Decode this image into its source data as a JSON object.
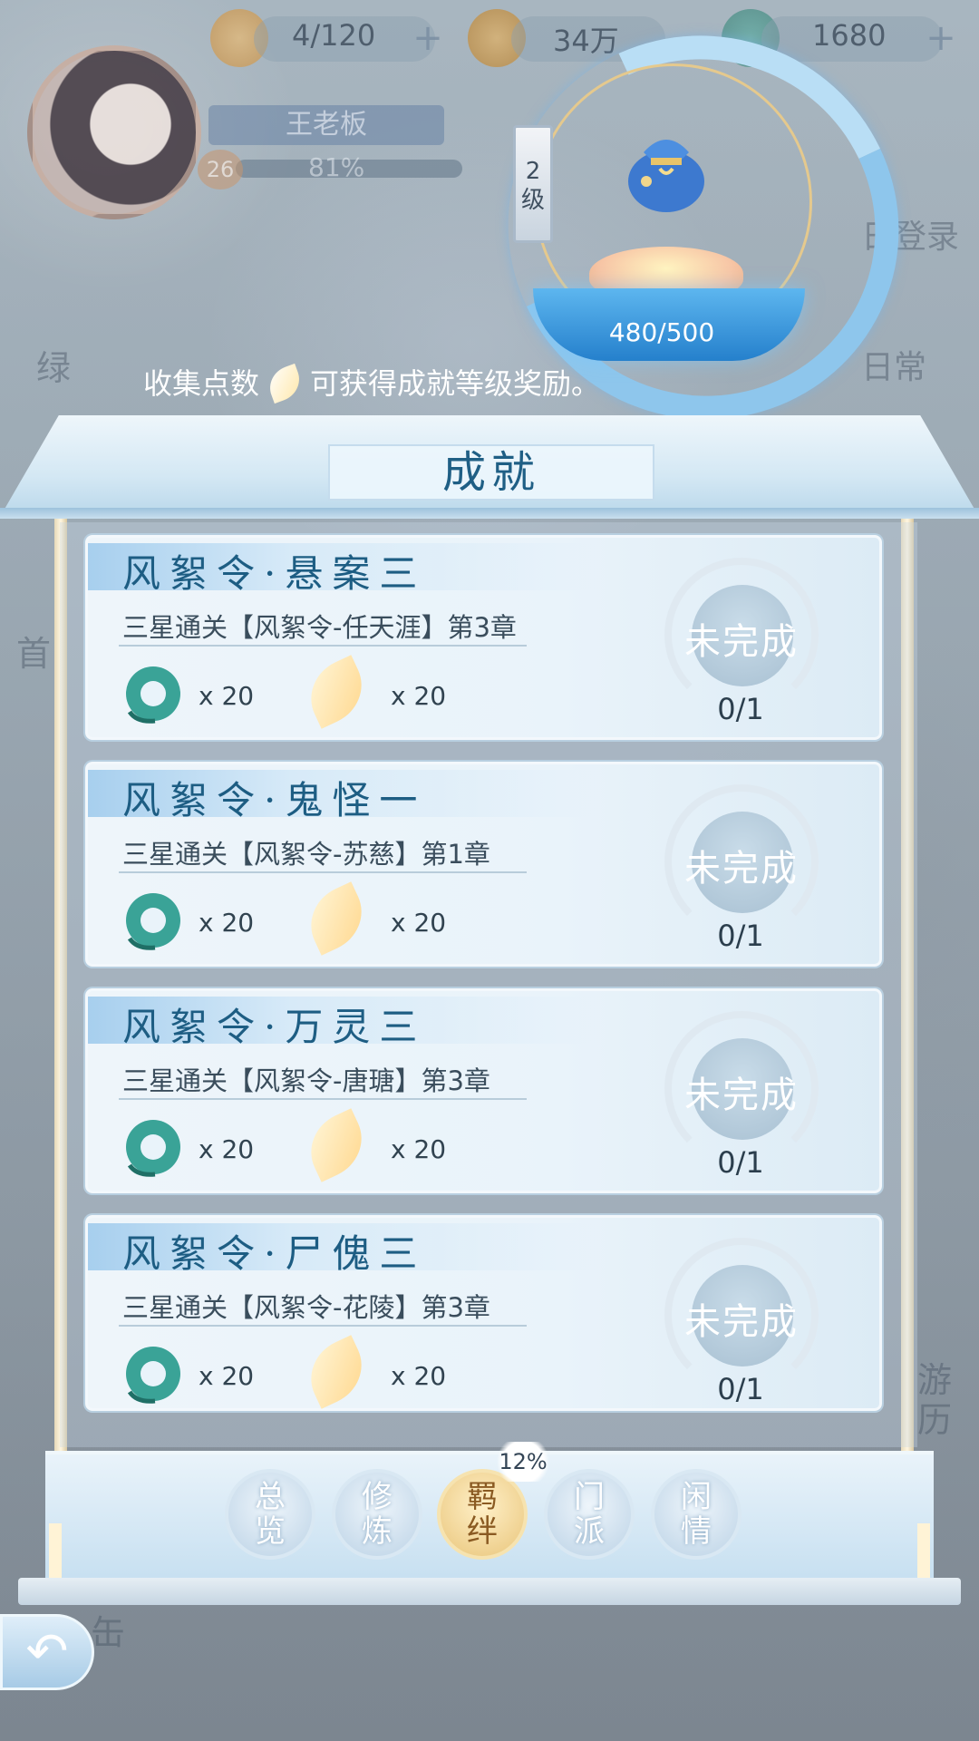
{
  "resources": [
    {
      "icon": "cat-face-icon",
      "value": "4/120"
    },
    {
      "icon": "gold-coin-icon",
      "value": "34万"
    },
    {
      "icon": "jade-icon",
      "value": "1680"
    }
  ],
  "player": {
    "name": "王老板",
    "level": "26",
    "exp": "81%"
  },
  "background_labels": {
    "left_top": "绿",
    "left_mid": "首",
    "right_login": "日登录",
    "right_daily": "日常",
    "right_bottom": "游\n历",
    "bottom_left": "缶"
  },
  "achievement_header": {
    "level_label": "2\n级",
    "progress": "480/500",
    "progress_fraction": 0.96,
    "hint_before": "收集点数",
    "hint_after": "可获得成就等级奖励。"
  },
  "panel_title": "成就",
  "achievements": [
    {
      "title": "风絮令·悬案三",
      "desc": "三星通关【风絮令-任天涯】第3章",
      "reward1_qty": "x 20",
      "reward2_qty": "x 20",
      "status": "未完成",
      "count": "0/1"
    },
    {
      "title": "风絮令·鬼怪一",
      "desc": "三星通关【风絮令-苏慈】第1章",
      "reward1_qty": "x 20",
      "reward2_qty": "x 20",
      "status": "未完成",
      "count": "0/1"
    },
    {
      "title": "风絮令·万灵三",
      "desc": "三星通关【风絮令-唐瑭】第3章",
      "reward1_qty": "x 20",
      "reward2_qty": "x 20",
      "status": "未完成",
      "count": "0/1"
    },
    {
      "title": "风絮令·尸傀三",
      "desc": "三星通关【风絮令-花陵】第3章",
      "reward1_qty": "x 20",
      "reward2_qty": "x 20",
      "status": "未完成",
      "count": "0/1"
    }
  ],
  "tabs": [
    {
      "label": "总\n览",
      "active": false
    },
    {
      "label": "修\n炼",
      "active": false
    },
    {
      "label": "羁\n绊",
      "active": true
    },
    {
      "label": "门\n派",
      "active": false
    },
    {
      "label": "闲\n情",
      "active": false
    }
  ],
  "tab_progress": "12%",
  "colors": {
    "accent": "#1d5d83",
    "ring": "#8ec6ec",
    "active_tab": "#e9c57a"
  }
}
